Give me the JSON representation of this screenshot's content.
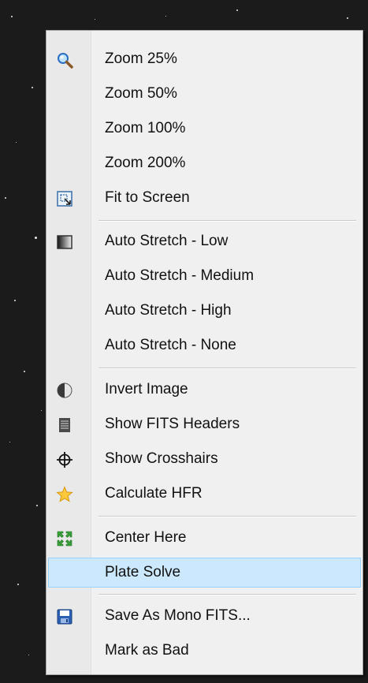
{
  "menu": {
    "items": [
      {
        "label": "Zoom 25%",
        "icon": "magnifier-icon"
      },
      {
        "label": "Zoom 50%"
      },
      {
        "label": "Zoom 100%"
      },
      {
        "label": "Zoom 200%"
      },
      {
        "label": "Fit to Screen",
        "icon": "fit-screen-icon"
      },
      {
        "label": "Auto Stretch - Low",
        "icon": "gradient-icon"
      },
      {
        "label": "Auto Stretch - Medium"
      },
      {
        "label": "Auto Stretch - High"
      },
      {
        "label": "Auto Stretch - None"
      },
      {
        "label": "Invert Image",
        "icon": "half-circle-icon"
      },
      {
        "label": "Show FITS Headers",
        "icon": "document-icon"
      },
      {
        "label": "Show Crosshairs",
        "icon": "crosshair-icon"
      },
      {
        "label": "Calculate HFR",
        "icon": "star-icon"
      },
      {
        "label": "Center Here",
        "icon": "center-arrows-icon"
      },
      {
        "label": "Plate Solve",
        "highlighted": true
      },
      {
        "label": "Save As Mono FITS...",
        "icon": "floppy-disk-icon"
      },
      {
        "label": "Mark as Bad"
      }
    ]
  },
  "colors": {
    "menu_background": "#f0f0f0",
    "highlight_background": "#cce8ff",
    "highlight_border": "#99d1ff",
    "sky_background": "#1b1b1b"
  }
}
